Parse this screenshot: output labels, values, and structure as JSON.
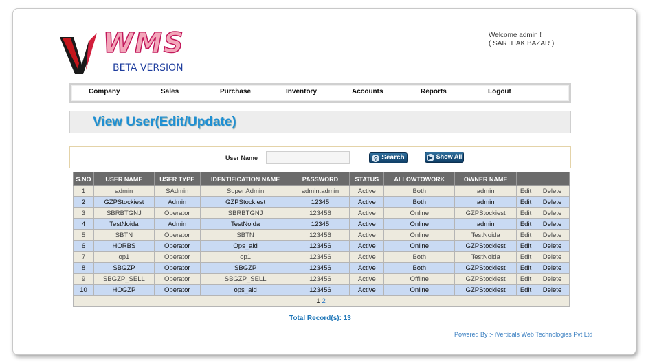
{
  "header": {
    "logo_text": "WMS",
    "beta": "BETA VERSION",
    "welcome_line1": "Welcome admin !",
    "welcome_line2": "( SARTHAK BAZAR )"
  },
  "nav": [
    "Company",
    "Sales",
    "Purchase",
    "Inventory",
    "Accounts",
    "Reports",
    "Logout"
  ],
  "page_title": "View User(Edit/Update)",
  "search": {
    "label": "User Name",
    "value": "",
    "search_button": "Search",
    "show_all_button": "Show All"
  },
  "table": {
    "columns": [
      "S.NO",
      "USER NAME",
      "USER TYPE",
      "IDENTIFICATION NAME",
      "PASSWORD",
      "STATUS",
      "ALLOWTOWORK",
      "OWNER NAME",
      "",
      ""
    ],
    "rows": [
      [
        "1",
        "admin",
        "SAdmin",
        "Super Admin",
        "admin.admin",
        "Active",
        "Both",
        "admin",
        "Edit",
        "Delete"
      ],
      [
        "2",
        "GZPStockiest",
        "Admin",
        "GZPStockiest",
        "12345",
        "Active",
        "Both",
        "admin",
        "Edit",
        "Delete"
      ],
      [
        "3",
        "SBRBTGNJ",
        "Operator",
        "SBRBTGNJ",
        "123456",
        "Active",
        "Online",
        "GZPStockiest",
        "Edit",
        "Delete"
      ],
      [
        "4",
        "TestNoida",
        "Admin",
        "TestNoida",
        "12345",
        "Active",
        "Online",
        "admin",
        "Edit",
        "Delete"
      ],
      [
        "5",
        "SBTN",
        "Operator",
        "SBTN",
        "123456",
        "Active",
        "Online",
        "TestNoida",
        "Edit",
        "Delete"
      ],
      [
        "6",
        "HORBS",
        "Operator",
        "Ops_ald",
        "123456",
        "Active",
        "Online",
        "GZPStockiest",
        "Edit",
        "Delete"
      ],
      [
        "7",
        "op1",
        "Operator",
        "op1",
        "123456",
        "Active",
        "Both",
        "TestNoida",
        "Edit",
        "Delete"
      ],
      [
        "8",
        "SBGZP",
        "Operator",
        "SBGZP",
        "123456",
        "Active",
        "Both",
        "GZPStockiest",
        "Edit",
        "Delete"
      ],
      [
        "9",
        "SBGZP_SELL",
        "Operator",
        "SBGZP_SELL",
        "123456",
        "Active",
        "Offline",
        "GZPStockiest",
        "Edit",
        "Delete"
      ],
      [
        "10",
        "HOGZP",
        "Operator",
        "ops_ald",
        "123456",
        "Active",
        "Online",
        "GZPStockiest",
        "Edit",
        "Delete"
      ]
    ],
    "pager": [
      "1",
      "2"
    ]
  },
  "total": "Total Record(s):  13",
  "footer": "Powered By :- iVerticals Web Technologies Pvt Ltd",
  "colors": {
    "title": "#1f8fd3",
    "header_row": "#6b6b6b",
    "row_odd": "#edeade",
    "row_even": "#c9daf3",
    "link": "#1f6fc2"
  }
}
